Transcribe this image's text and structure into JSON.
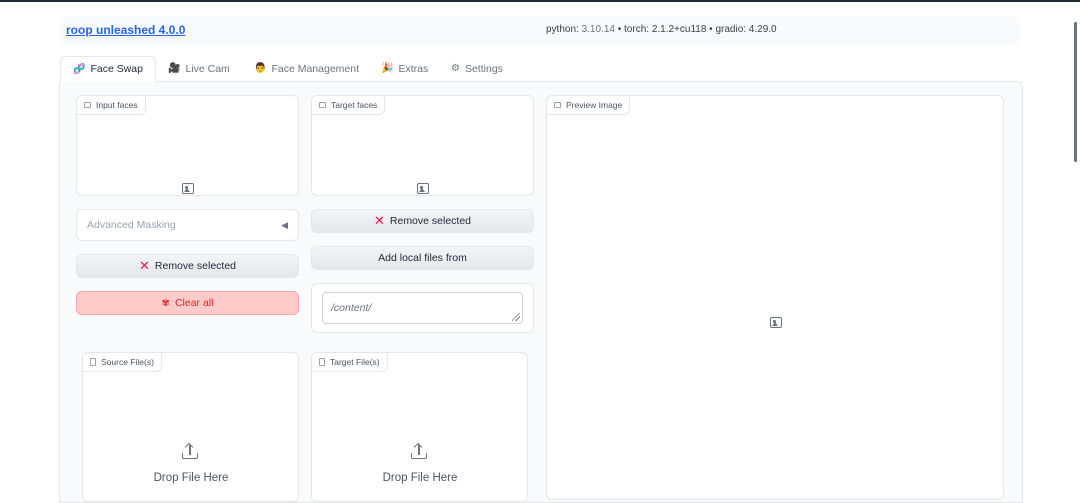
{
  "header": {
    "app_title": "roop unleashed 4.0.0",
    "python_label": "python: ",
    "python_version": "3.10.14",
    "torch_label": " • torch: 2.1.2+cu118 • gradio: 4.29.0"
  },
  "tabs": [
    {
      "label": "Face Swap",
      "icon": "face-swap-icon",
      "active": true
    },
    {
      "label": "Live Cam",
      "icon": "camera-icon",
      "active": false
    },
    {
      "label": "Face Management",
      "icon": "face-management-icon",
      "active": false
    },
    {
      "label": "Extras",
      "icon": "extras-icon",
      "active": false
    },
    {
      "label": "Settings",
      "icon": "gear-icon",
      "active": false
    }
  ],
  "face_swap": {
    "input_faces_label": "Input faces",
    "target_faces_label": "Target faces",
    "preview_label": "Preview Image",
    "advanced_masking_label": "Advanced Masking",
    "remove_selected_left": "Remove selected",
    "remove_selected_right": "Remove selected",
    "clear_all": "Clear all",
    "add_local_files": "Add local files from",
    "local_path_value": "/content/",
    "source_files_label": "Source File(s)",
    "target_files_label": "Target File(s)",
    "drop_file_left": "Drop File Here",
    "drop_file_right": "Drop File Here"
  },
  "colors": {
    "accent": "#2563eb",
    "danger": "#dc2626",
    "danger_bg": "#fecaca",
    "remove_icon": "#e11d48"
  }
}
